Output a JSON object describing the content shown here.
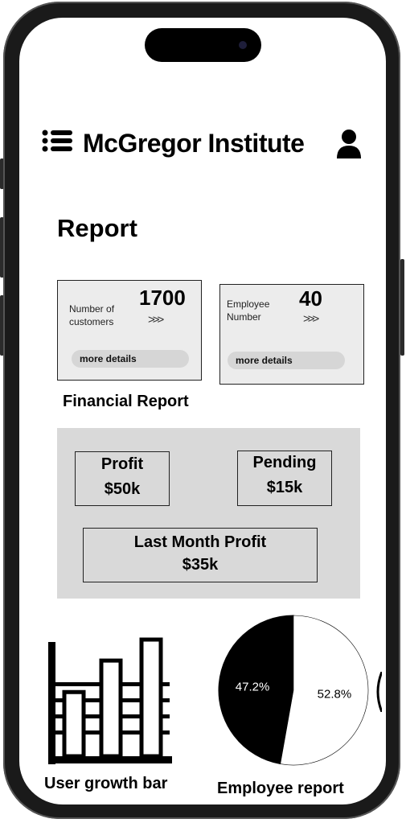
{
  "header": {
    "title": "McGregor Institute",
    "menu_icon": "menu-list-icon",
    "user_icon": "user-icon"
  },
  "page": {
    "title": "Report"
  },
  "stats": [
    {
      "label_line1": "Number of",
      "label_line2": "customers",
      "value": "1700",
      "arrows": ">>>",
      "button": "more details"
    },
    {
      "label_line1": "Employee",
      "label_line2": "Number",
      "value": "40",
      "arrows": ">>>",
      "button": "more details"
    }
  ],
  "financial": {
    "title": "Financial Report",
    "profit": {
      "label": "Profit",
      "value": "$50k"
    },
    "pending": {
      "label": "Pending",
      "value": "$15k"
    },
    "last_month": {
      "label": "Last Month Profit",
      "value": "$35k"
    }
  },
  "user_growth": {
    "caption": "User growth bar",
    "bars": [
      0.55,
      0.82,
      1.0
    ]
  },
  "employee_report": {
    "caption": "Employee report",
    "chart_data": {
      "type": "pie",
      "slices": [
        {
          "label": "47.2%",
          "value": 47.2,
          "color": "#000000"
        },
        {
          "label": "52.8%",
          "value": 52.8,
          "color": "#ffffff"
        }
      ]
    }
  }
}
